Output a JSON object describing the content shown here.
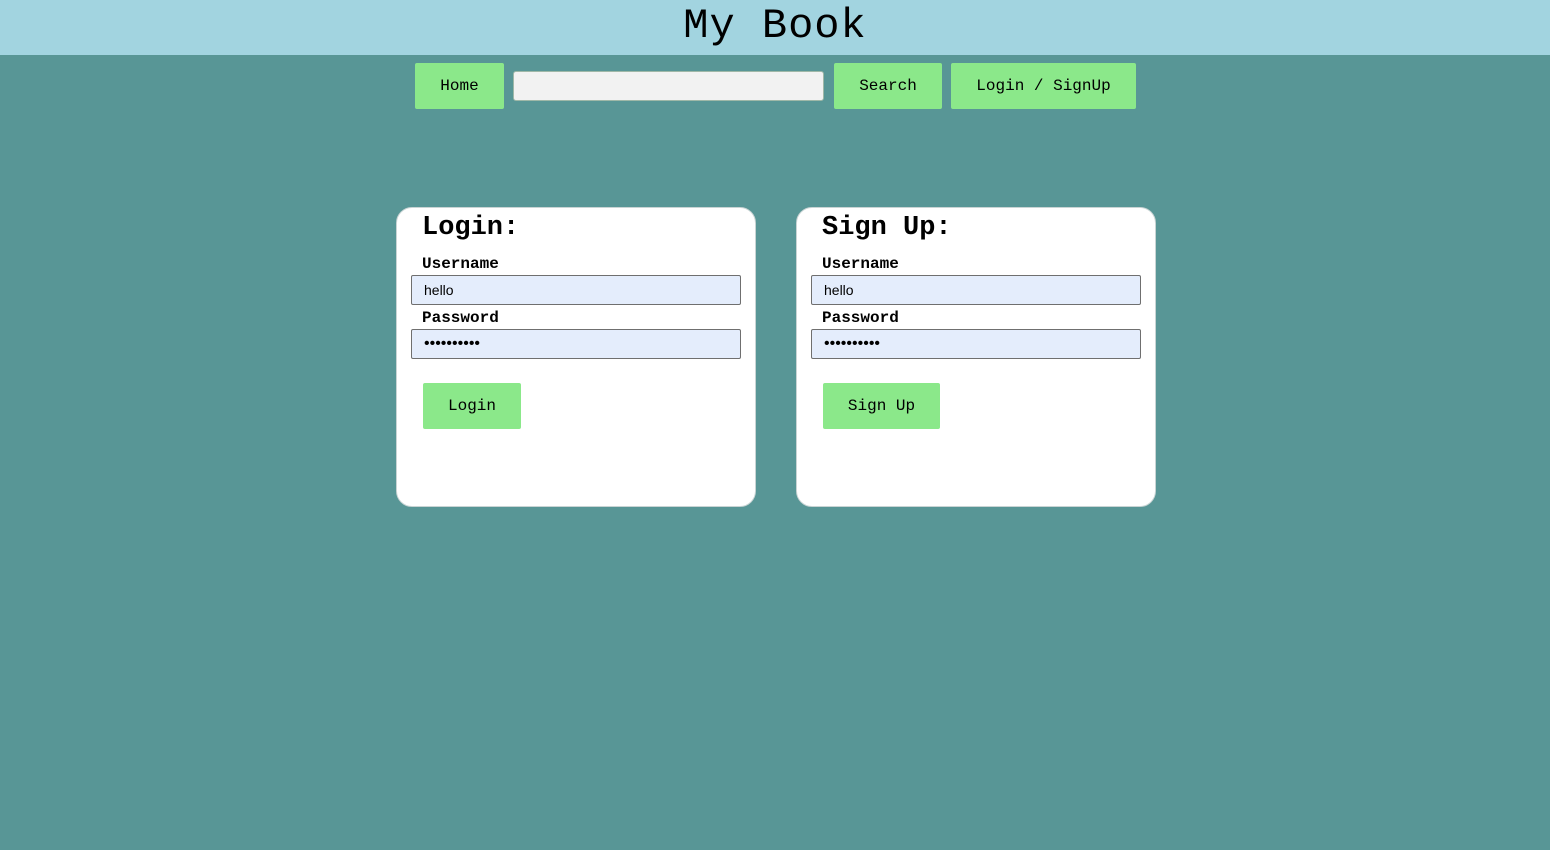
{
  "header": {
    "title": "My Book"
  },
  "nav": {
    "home_label": "Home",
    "search_value": "",
    "search_label": "Search",
    "login_signup_label": "Login / SignUp"
  },
  "login": {
    "title": "Login:",
    "username_label": "Username",
    "username_value": "hello",
    "password_label": "Password",
    "password_value": "helloworld",
    "submit_label": "Login"
  },
  "signup": {
    "title": "Sign Up:",
    "username_label": "Username",
    "username_value": "hello",
    "password_label": "Password",
    "password_value": "helloworld",
    "submit_label": "Sign Up"
  },
  "colors": {
    "page_background": "#589696",
    "header_background": "#a2d4e0",
    "button_green": "#8be88a",
    "card_background": "#ffffff",
    "input_background": "#e4edfc"
  }
}
